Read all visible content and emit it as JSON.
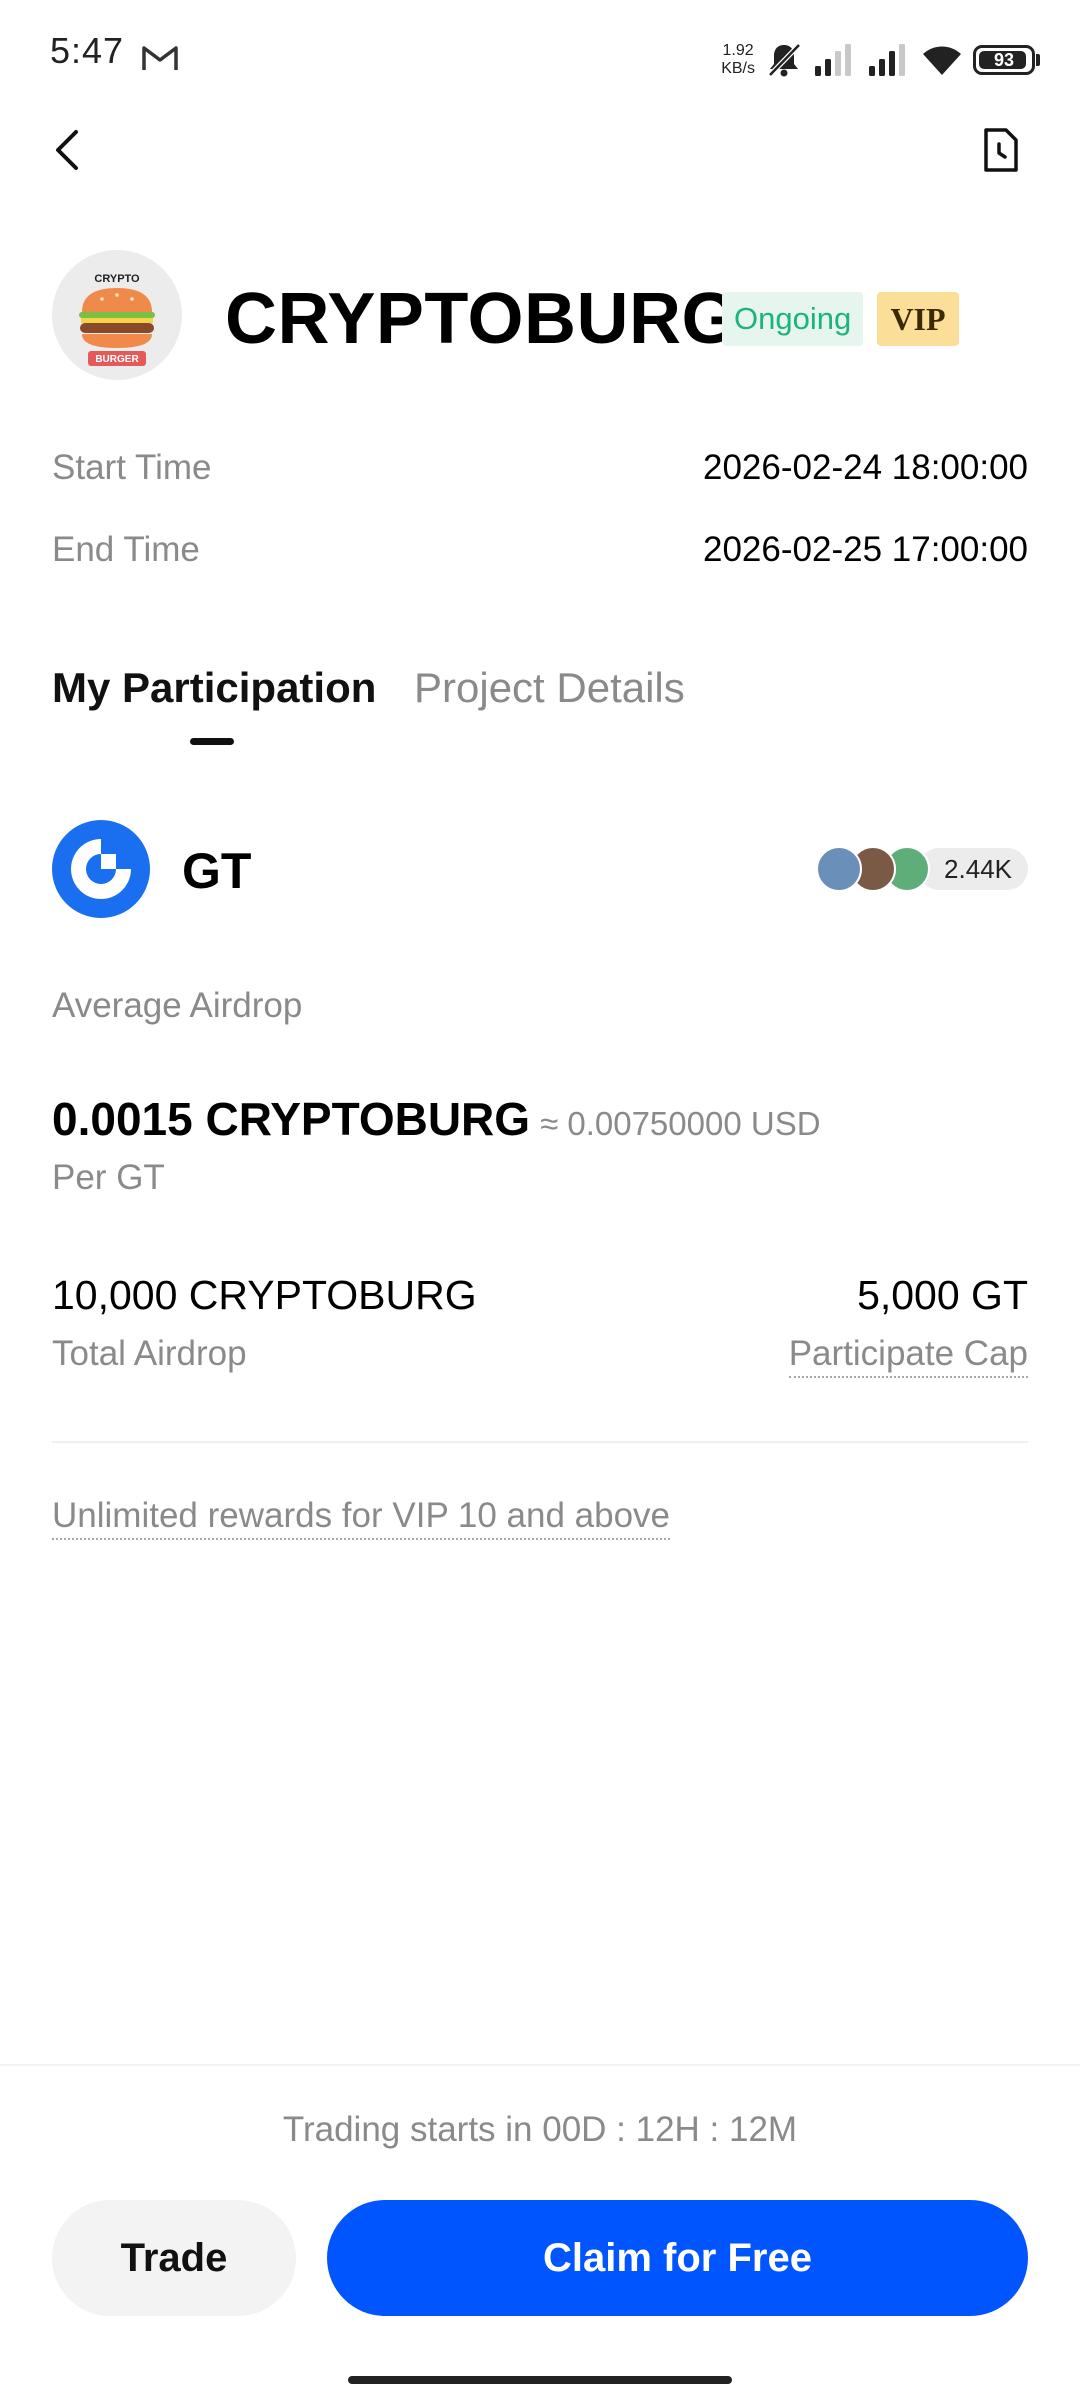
{
  "status_bar": {
    "time": "5:47",
    "net_speed_value": "1.92",
    "net_speed_unit": "KB/s",
    "battery": "93",
    "battery_level": 0.93,
    "icons": [
      "gmail-icon",
      "bell-muted-icon",
      "signal-icon",
      "signal-icon",
      "wifi-icon",
      "battery-icon"
    ]
  },
  "header": {
    "back_icon": "chevron-left-icon",
    "history_icon": "document-clock-icon"
  },
  "project": {
    "name": "CRYPTOBURG",
    "status": "Ongoing",
    "tier": "VIP",
    "logo_text_top": "CRYPTO",
    "logo_text_bottom": "BURGER"
  },
  "schedule": {
    "start_label": "Start Time",
    "start_value": "2026-02-24 18:00:00",
    "end_label": "End Time",
    "end_value": "2026-02-25 17:00:00"
  },
  "tabs": [
    {
      "label": "My Participation",
      "active": true
    },
    {
      "label": "Project Details",
      "active": false
    }
  ],
  "token": {
    "symbol": "GT",
    "participants": "2.44K"
  },
  "airdrop": {
    "average_label": "Average Airdrop",
    "average_amount": "0.0015 CRYPTOBURG",
    "average_usd": "≈ 0.00750000 USD",
    "per_unit": "Per GT",
    "total_value": "10,000 CRYPTOBURG",
    "total_label": "Total Airdrop",
    "cap_value": "5,000 GT",
    "cap_label": "Participate Cap",
    "vip_note": "Unlimited rewards for VIP 10 and above"
  },
  "footer": {
    "countdown": "Trading starts in 00D : 12H : 12M",
    "trade_label": "Trade",
    "claim_label": "Claim for Free"
  },
  "colors": {
    "accent": "#0055ff",
    "ongoing_text": "#1db37a",
    "ongoing_bg": "#e6f6ef",
    "vip_bg": "#fbdf98",
    "muted_text": "#8a8a8a"
  }
}
